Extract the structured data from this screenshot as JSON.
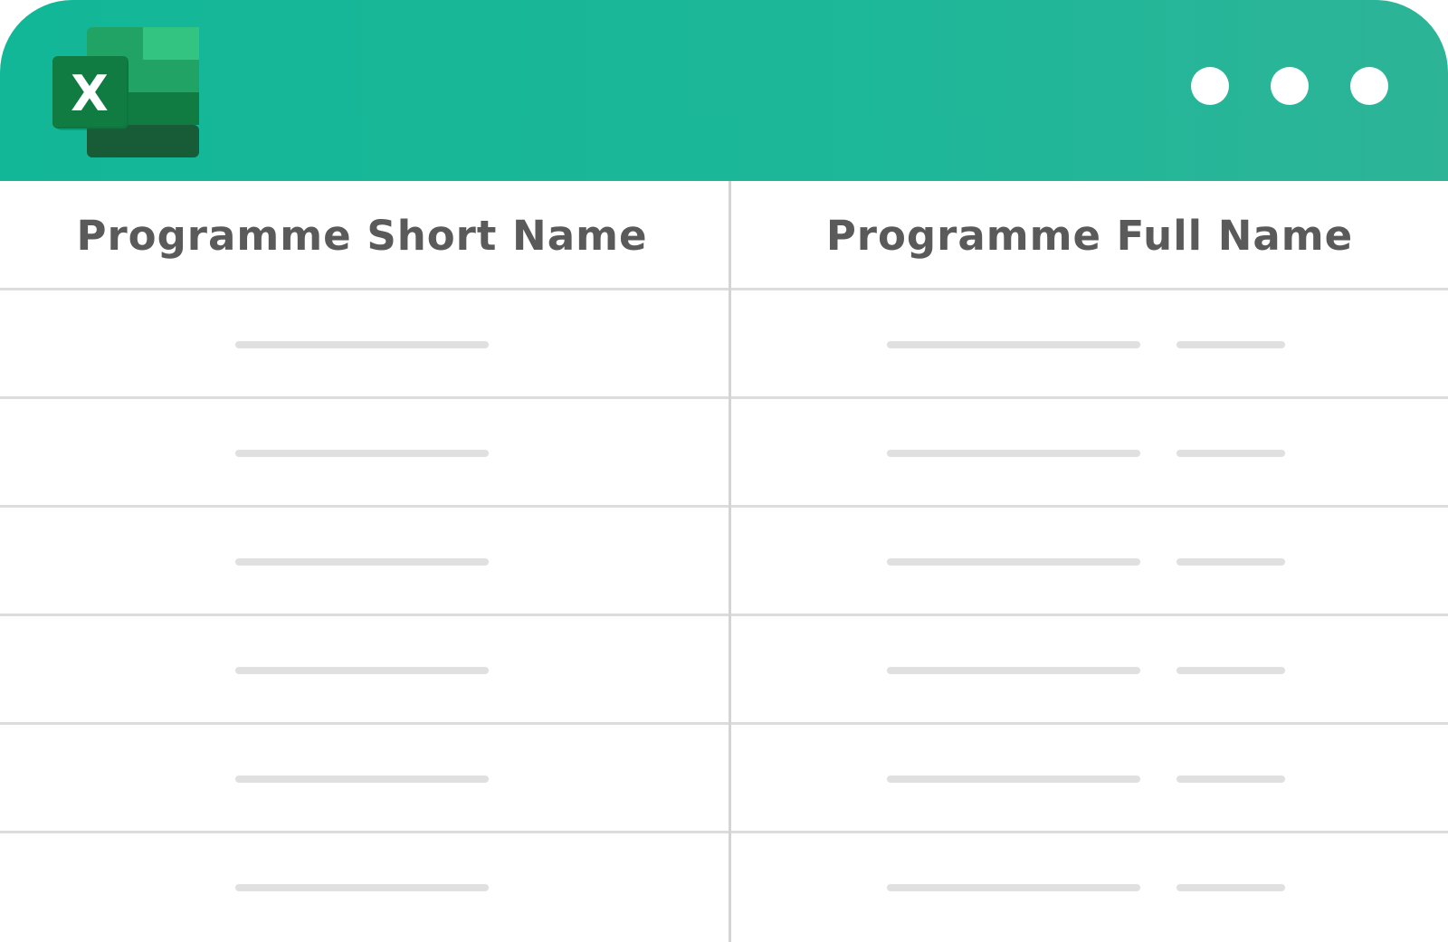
{
  "app": {
    "icon": "excel-icon",
    "logo_letter": "X",
    "colors": {
      "title_bar": "#12b797",
      "logo_dark": "#185c37",
      "logo_mid": "#107c41",
      "logo_light": "#21a366",
      "logo_accent": "#33c481"
    }
  },
  "window_controls": [
    "dot",
    "dot",
    "dot"
  ],
  "table": {
    "headers": {
      "short_name": "Programme Short Name",
      "full_name": "Programme Full Name"
    },
    "row_count": 6
  }
}
